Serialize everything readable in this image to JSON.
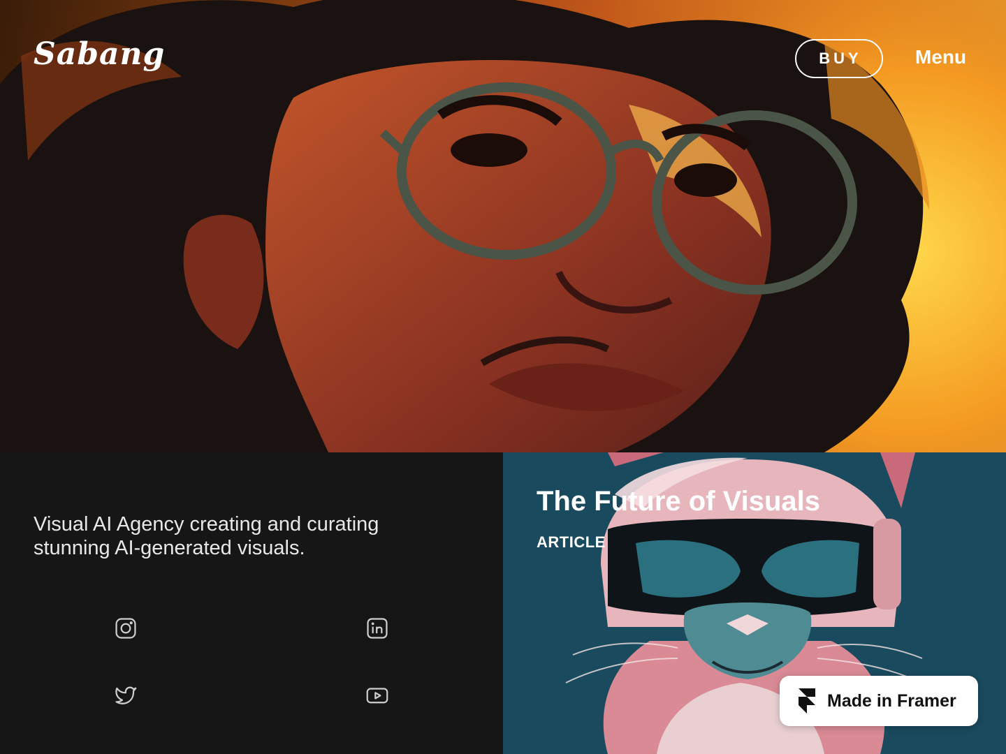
{
  "header": {
    "logo_text": "Sabang",
    "buy_label": "BUY",
    "menu_label": "Menu"
  },
  "hero": {
    "image_icon": "hero-portrait-image"
  },
  "intro": {
    "tagline": "Visual AI Agency creating and curating stunning AI-generated visuals."
  },
  "social": {
    "items": [
      {
        "icon": "instagram-icon"
      },
      {
        "icon": "linkedin-icon"
      },
      {
        "icon": "twitter-icon"
      },
      {
        "icon": "youtube-icon"
      }
    ]
  },
  "article": {
    "title": "The Future of Visuals",
    "tag": "ARTICLE",
    "image_icon": "cat-vr-image"
  },
  "badge": {
    "label": "Made in Framer",
    "icon": "framer-logo-icon"
  },
  "colors": {
    "hero_warm": "#f29a20",
    "panel_dark": "#161616",
    "article_bg": "#1a4a5e",
    "white": "#ffffff"
  }
}
